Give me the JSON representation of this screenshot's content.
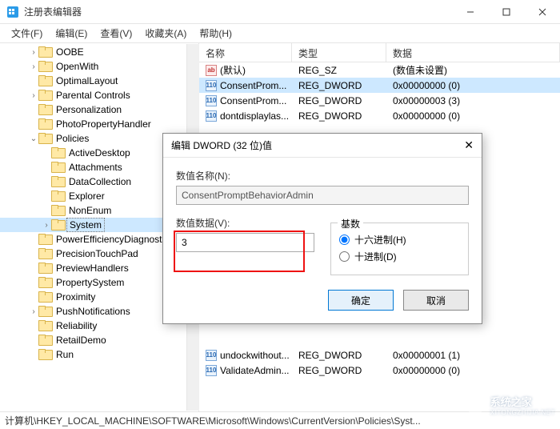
{
  "window": {
    "title": "注册表编辑器",
    "status_path": "计算机\\HKEY_LOCAL_MACHINE\\SOFTWARE\\Microsoft\\Windows\\CurrentVersion\\Policies\\Syst..."
  },
  "menu": {
    "file": "文件(F)",
    "edit": "编辑(E)",
    "view": "查看(V)",
    "favorites": "收藏夹(A)",
    "help": "帮助(H)"
  },
  "tree": {
    "items": [
      {
        "indent": 2,
        "chev": "right",
        "label": "OOBE"
      },
      {
        "indent": 2,
        "chev": "right",
        "label": "OpenWith"
      },
      {
        "indent": 2,
        "chev": "none",
        "label": "OptimalLayout"
      },
      {
        "indent": 2,
        "chev": "right",
        "label": "Parental Controls"
      },
      {
        "indent": 2,
        "chev": "none",
        "label": "Personalization"
      },
      {
        "indent": 2,
        "chev": "none",
        "label": "PhotoPropertyHandler"
      },
      {
        "indent": 2,
        "chev": "down",
        "label": "Policies"
      },
      {
        "indent": 3,
        "chev": "none",
        "label": "ActiveDesktop"
      },
      {
        "indent": 3,
        "chev": "none",
        "label": "Attachments"
      },
      {
        "indent": 3,
        "chev": "none",
        "label": "DataCollection"
      },
      {
        "indent": 3,
        "chev": "none",
        "label": "Explorer"
      },
      {
        "indent": 3,
        "chev": "none",
        "label": "NonEnum"
      },
      {
        "indent": 3,
        "chev": "right",
        "label": "System",
        "selected": true
      },
      {
        "indent": 2,
        "chev": "none",
        "label": "PowerEfficiencyDiagnostics"
      },
      {
        "indent": 2,
        "chev": "none",
        "label": "PrecisionTouchPad"
      },
      {
        "indent": 2,
        "chev": "none",
        "label": "PreviewHandlers"
      },
      {
        "indent": 2,
        "chev": "none",
        "label": "PropertySystem"
      },
      {
        "indent": 2,
        "chev": "none",
        "label": "Proximity"
      },
      {
        "indent": 2,
        "chev": "right",
        "label": "PushNotifications"
      },
      {
        "indent": 2,
        "chev": "none",
        "label": "Reliability"
      },
      {
        "indent": 2,
        "chev": "none",
        "label": "RetailDemo"
      },
      {
        "indent": 2,
        "chev": "none",
        "label": "Run"
      }
    ]
  },
  "list": {
    "cols": {
      "name": "名称",
      "type": "类型",
      "data": "数据"
    },
    "rows": [
      {
        "icon": "sz",
        "name": "(默认)",
        "type": "REG_SZ",
        "data": "(数值未设置)"
      },
      {
        "icon": "dw",
        "name": "ConsentProm...",
        "type": "REG_DWORD",
        "data": "0x00000000 (0)",
        "selected": true
      },
      {
        "icon": "dw",
        "name": "ConsentProm...",
        "type": "REG_DWORD",
        "data": "0x00000003 (3)"
      },
      {
        "icon": "dw",
        "name": "dontdisplaylas...",
        "type": "REG_DWORD",
        "data": "0x00000000 (0)"
      },
      {
        "icon": "dw",
        "name": "undockwithout...",
        "type": "REG_DWORD",
        "data": "0x00000001 (1)"
      },
      {
        "icon": "dw",
        "name": "ValidateAdmin...",
        "type": "REG_DWORD",
        "data": "0x00000000 (0)"
      }
    ]
  },
  "dialog": {
    "title": "编辑 DWORD (32 位)值",
    "name_label": "数值名称(N):",
    "name_value": "ConsentPromptBehaviorAdmin",
    "data_label": "数值数据(V):",
    "data_value": "3",
    "base_label": "基数",
    "radio_hex": "十六进制(H)",
    "radio_dec": "十进制(D)",
    "ok": "确定",
    "cancel": "取消"
  },
  "watermark": {
    "text": "系统之家",
    "url": "XITONGZHIJIA.NET"
  }
}
